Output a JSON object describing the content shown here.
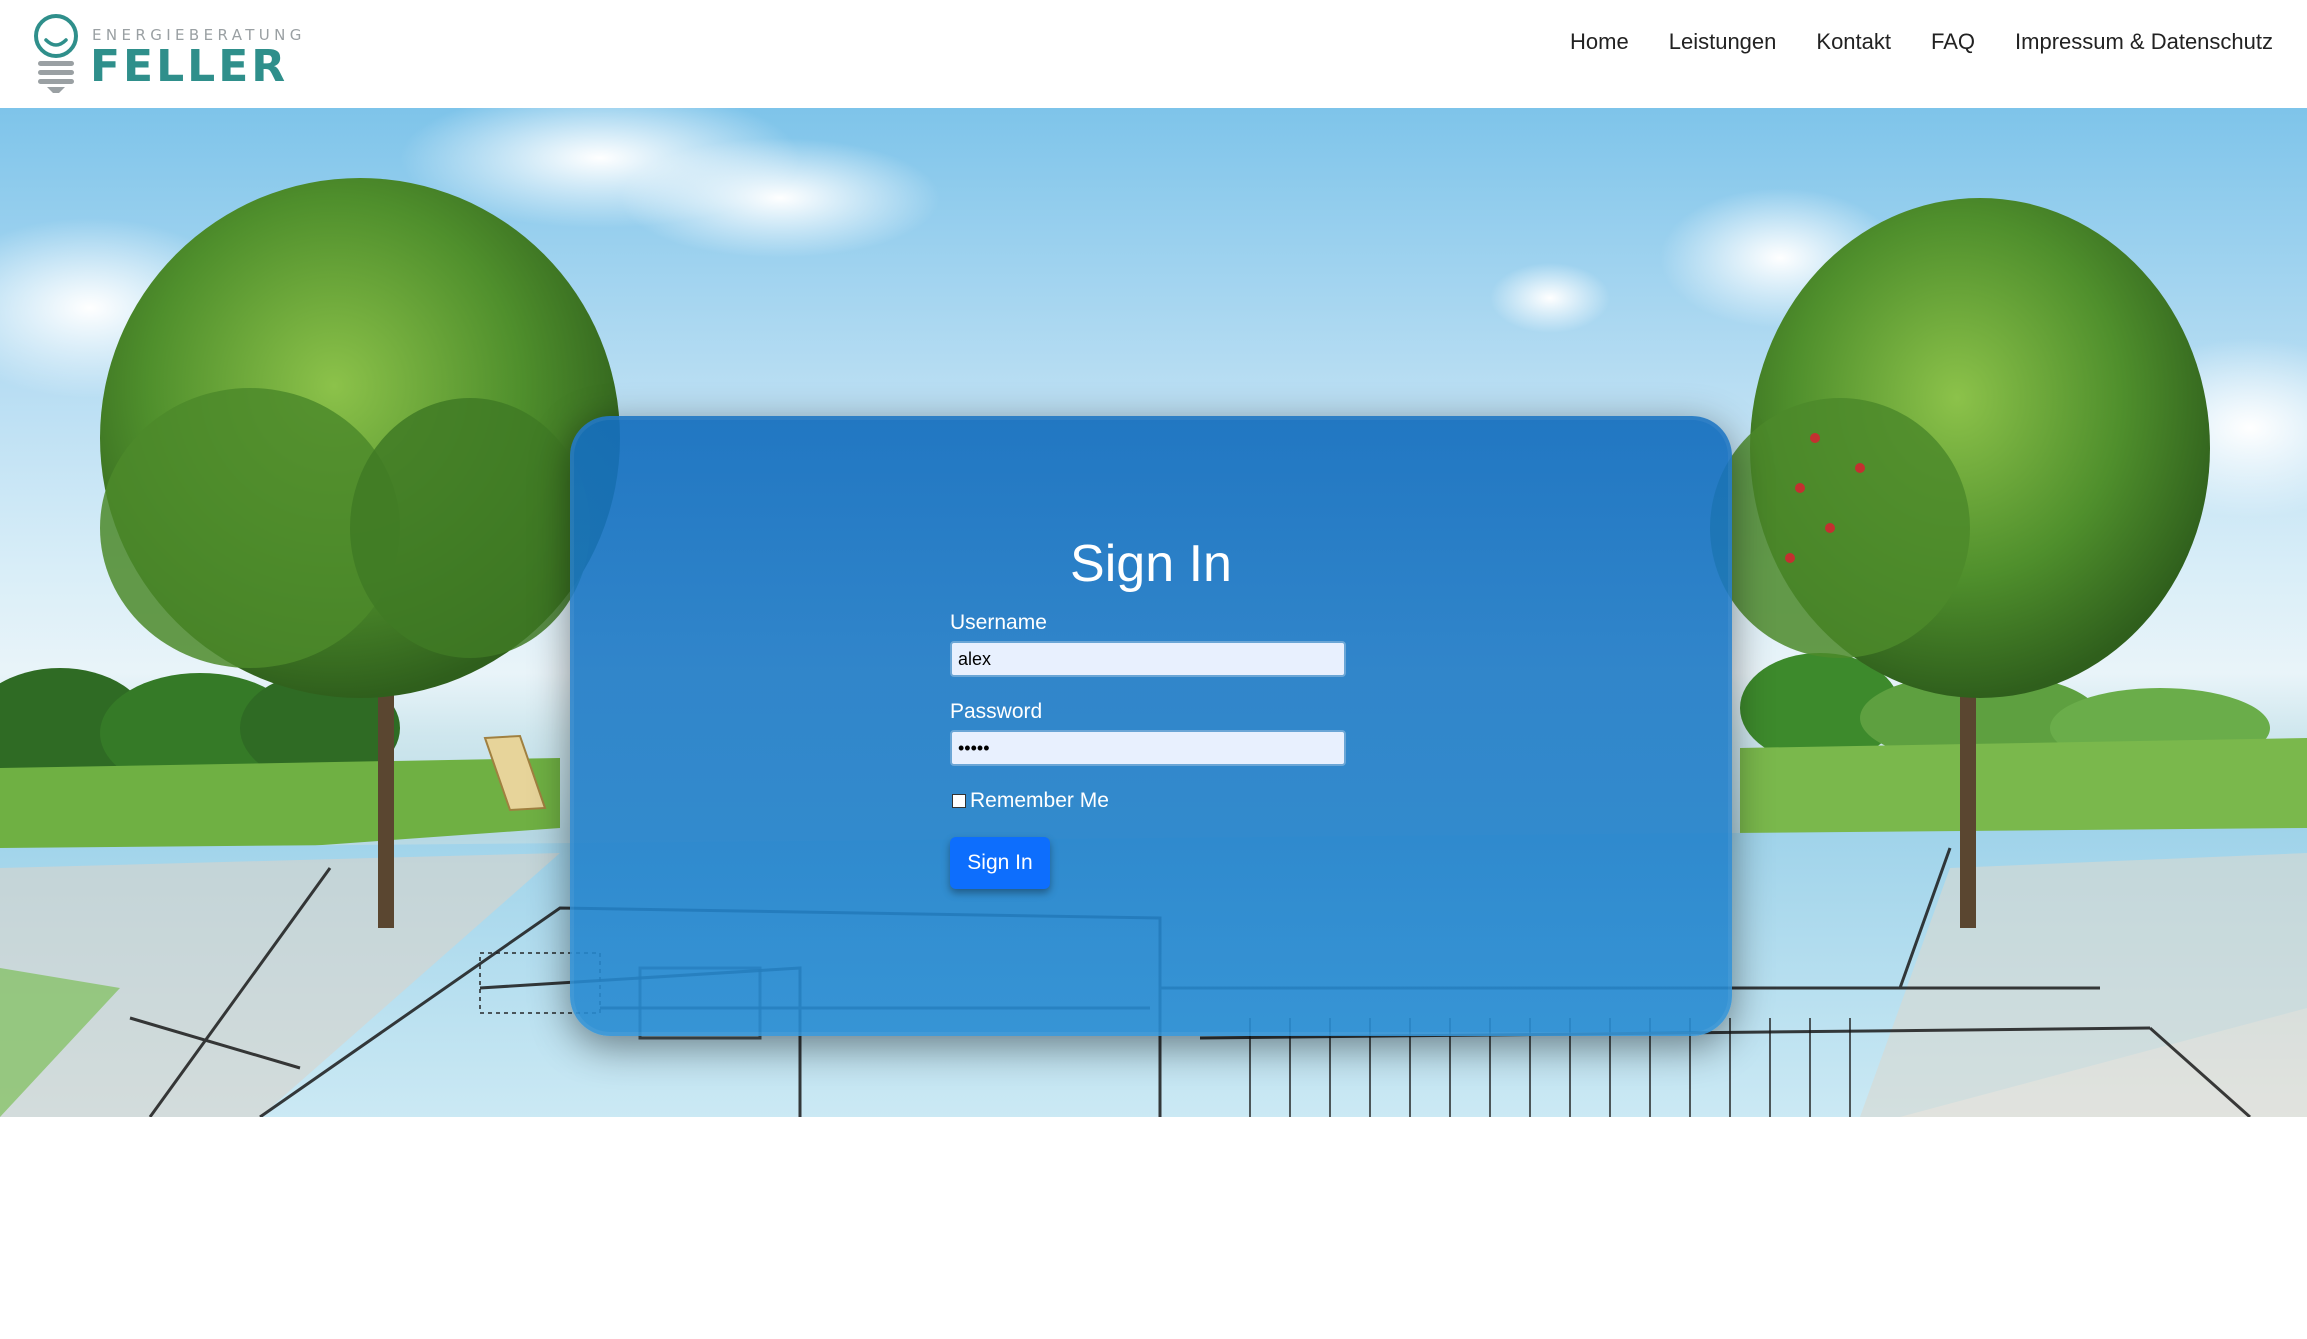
{
  "header": {
    "logo": {
      "subtitle": "ENERGIEBERATUNG",
      "name": "FELLER"
    },
    "nav": [
      {
        "label": "Home"
      },
      {
        "label": "Leistungen"
      },
      {
        "label": "Kontakt"
      },
      {
        "label": "FAQ"
      },
      {
        "label": "Impressum & Datenschutz"
      }
    ]
  },
  "login": {
    "title": "Sign In",
    "username_label": "Username",
    "username_value": "alex",
    "password_label": "Password",
    "password_value": "•••••",
    "remember_label": "Remember Me",
    "remember_checked": false,
    "submit_label": "Sign In"
  },
  "colors": {
    "brand": "#2f8f8b",
    "card": "#1e7dc8",
    "button": "#0d6efd"
  }
}
